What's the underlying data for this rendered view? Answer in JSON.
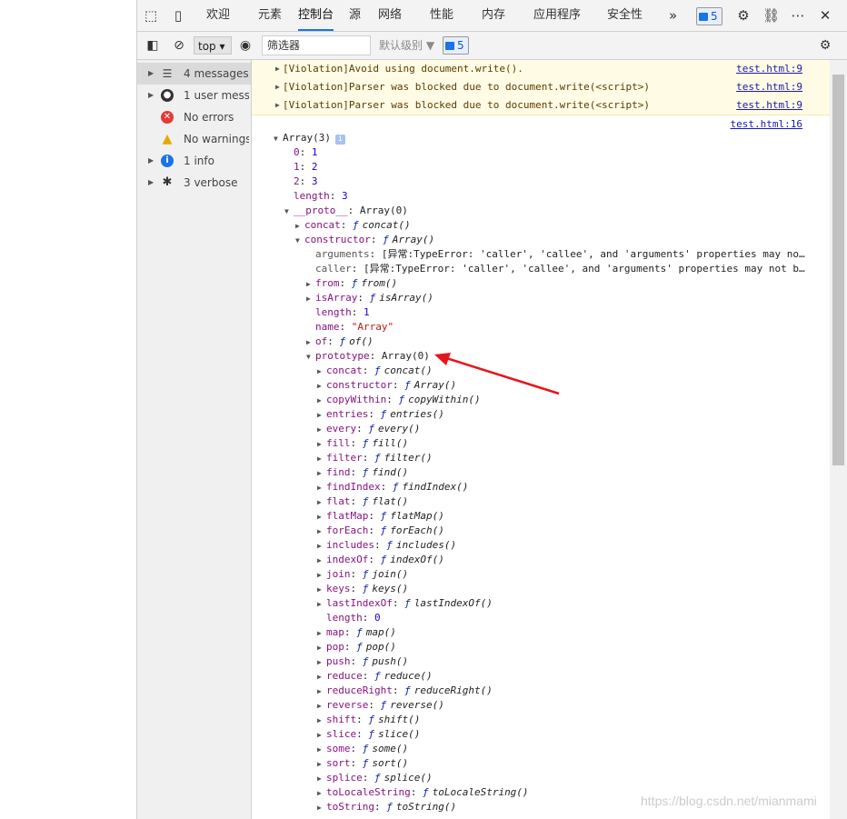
{
  "tabs": [
    "欢迎",
    "元素",
    "控制台",
    "源",
    "网络",
    "性能",
    "内存",
    "应用程序",
    "安全性"
  ],
  "active_tab": "控制台",
  "more_tabs": "»",
  "issues_count": "5",
  "toolbar": {
    "context": "top",
    "filter_placeholder": "筛选器",
    "levels": "默认级别 ▼",
    "issues_count": "5"
  },
  "sidebar": {
    "items": [
      {
        "label": "4 messages",
        "icon": "list-icon"
      },
      {
        "label": "1 user mess...",
        "icon": "user-icon"
      },
      {
        "label": "No errors",
        "icon": "error-icon"
      },
      {
        "label": "No warnings",
        "icon": "warning-icon"
      },
      {
        "label": "1 info",
        "icon": "info-icon"
      },
      {
        "label": "3 verbose",
        "icon": "bug-icon"
      }
    ]
  },
  "violations": [
    {
      "text": "[Violation]Avoid using document.write().",
      "link": "test.html:9"
    },
    {
      "text": "[Violation]Parser was blocked due to document.write(<script>)",
      "link": "test.html:9"
    },
    {
      "text": "[Violation]Parser was blocked due to document.write(<script>)",
      "link": "test.html:9"
    }
  ],
  "log_link": "test.html:16",
  "tree": [
    {
      "d": 0,
      "t": "open",
      "k": "",
      "v": "Array(3)",
      "info": true
    },
    {
      "d": 1,
      "t": "none",
      "k": "0",
      "v": "1",
      "vt": "num"
    },
    {
      "d": 1,
      "t": "none",
      "k": "1",
      "v": "2",
      "vt": "num"
    },
    {
      "d": 1,
      "t": "none",
      "k": "2",
      "v": "3",
      "vt": "num"
    },
    {
      "d": 1,
      "t": "none",
      "k": "length",
      "v": "3",
      "vt": "num"
    },
    {
      "d": 1,
      "t": "open",
      "k": "__proto__",
      "v": "Array(0)"
    },
    {
      "d": 2,
      "t": "closed",
      "k": "concat",
      "v": "concat()",
      "vt": "fn"
    },
    {
      "d": 2,
      "t": "open",
      "k": "constructor",
      "v": "Array()",
      "vt": "fn"
    },
    {
      "d": 3,
      "t": "none",
      "k": "arguments",
      "v": "[异常:TypeError: 'caller', 'callee', and 'arguments' properties may no…",
      "kd": true
    },
    {
      "d": 3,
      "t": "none",
      "k": "caller",
      "v": "[异常:TypeError: 'caller', 'callee', and 'arguments' properties may not b…",
      "kd": true
    },
    {
      "d": 3,
      "t": "closed",
      "k": "from",
      "v": "from()",
      "vt": "fn"
    },
    {
      "d": 3,
      "t": "closed",
      "k": "isArray",
      "v": "isArray()",
      "vt": "fn"
    },
    {
      "d": 3,
      "t": "none",
      "k": "length",
      "v": "1",
      "vt": "num"
    },
    {
      "d": 3,
      "t": "none",
      "k": "name",
      "v": "\"Array\"",
      "vt": "str"
    },
    {
      "d": 3,
      "t": "closed",
      "k": "of",
      "v": "of()",
      "vt": "fn"
    },
    {
      "d": 3,
      "t": "open",
      "k": "prototype",
      "v": "Array(0)"
    },
    {
      "d": 4,
      "t": "closed",
      "k": "concat",
      "v": "concat()",
      "vt": "fn"
    },
    {
      "d": 4,
      "t": "closed",
      "k": "constructor",
      "v": "Array()",
      "vt": "fn"
    },
    {
      "d": 4,
      "t": "closed",
      "k": "copyWithin",
      "v": "copyWithin()",
      "vt": "fn"
    },
    {
      "d": 4,
      "t": "closed",
      "k": "entries",
      "v": "entries()",
      "vt": "fn"
    },
    {
      "d": 4,
      "t": "closed",
      "k": "every",
      "v": "every()",
      "vt": "fn"
    },
    {
      "d": 4,
      "t": "closed",
      "k": "fill",
      "v": "fill()",
      "vt": "fn"
    },
    {
      "d": 4,
      "t": "closed",
      "k": "filter",
      "v": "filter()",
      "vt": "fn"
    },
    {
      "d": 4,
      "t": "closed",
      "k": "find",
      "v": "find()",
      "vt": "fn"
    },
    {
      "d": 4,
      "t": "closed",
      "k": "findIndex",
      "v": "findIndex()",
      "vt": "fn"
    },
    {
      "d": 4,
      "t": "closed",
      "k": "flat",
      "v": "flat()",
      "vt": "fn"
    },
    {
      "d": 4,
      "t": "closed",
      "k": "flatMap",
      "v": "flatMap()",
      "vt": "fn"
    },
    {
      "d": 4,
      "t": "closed",
      "k": "forEach",
      "v": "forEach()",
      "vt": "fn"
    },
    {
      "d": 4,
      "t": "closed",
      "k": "includes",
      "v": "includes()",
      "vt": "fn"
    },
    {
      "d": 4,
      "t": "closed",
      "k": "indexOf",
      "v": "indexOf()",
      "vt": "fn"
    },
    {
      "d": 4,
      "t": "closed",
      "k": "join",
      "v": "join()",
      "vt": "fn"
    },
    {
      "d": 4,
      "t": "closed",
      "k": "keys",
      "v": "keys()",
      "vt": "fn"
    },
    {
      "d": 4,
      "t": "closed",
      "k": "lastIndexOf",
      "v": "lastIndexOf()",
      "vt": "fn"
    },
    {
      "d": 4,
      "t": "none",
      "k": "length",
      "v": "0",
      "vt": "num"
    },
    {
      "d": 4,
      "t": "closed",
      "k": "map",
      "v": "map()",
      "vt": "fn"
    },
    {
      "d": 4,
      "t": "closed",
      "k": "pop",
      "v": "pop()",
      "vt": "fn"
    },
    {
      "d": 4,
      "t": "closed",
      "k": "push",
      "v": "push()",
      "vt": "fn"
    },
    {
      "d": 4,
      "t": "closed",
      "k": "reduce",
      "v": "reduce()",
      "vt": "fn"
    },
    {
      "d": 4,
      "t": "closed",
      "k": "reduceRight",
      "v": "reduceRight()",
      "vt": "fn"
    },
    {
      "d": 4,
      "t": "closed",
      "k": "reverse",
      "v": "reverse()",
      "vt": "fn"
    },
    {
      "d": 4,
      "t": "closed",
      "k": "shift",
      "v": "shift()",
      "vt": "fn"
    },
    {
      "d": 4,
      "t": "closed",
      "k": "slice",
      "v": "slice()",
      "vt": "fn"
    },
    {
      "d": 4,
      "t": "closed",
      "k": "some",
      "v": "some()",
      "vt": "fn"
    },
    {
      "d": 4,
      "t": "closed",
      "k": "sort",
      "v": "sort()",
      "vt": "fn"
    },
    {
      "d": 4,
      "t": "closed",
      "k": "splice",
      "v": "splice()",
      "vt": "fn"
    },
    {
      "d": 4,
      "t": "closed",
      "k": "toLocaleString",
      "v": "toLocaleString()",
      "vt": "fn"
    },
    {
      "d": 4,
      "t": "closed",
      "k": "toString",
      "v": "toString()",
      "vt": "fn"
    }
  ],
  "watermark": "https://blog.csdn.net/mianmami",
  "colors": {
    "accent": "#1a73e8",
    "arrow": "#e8141b",
    "violation_bg": "#fffbe5"
  }
}
